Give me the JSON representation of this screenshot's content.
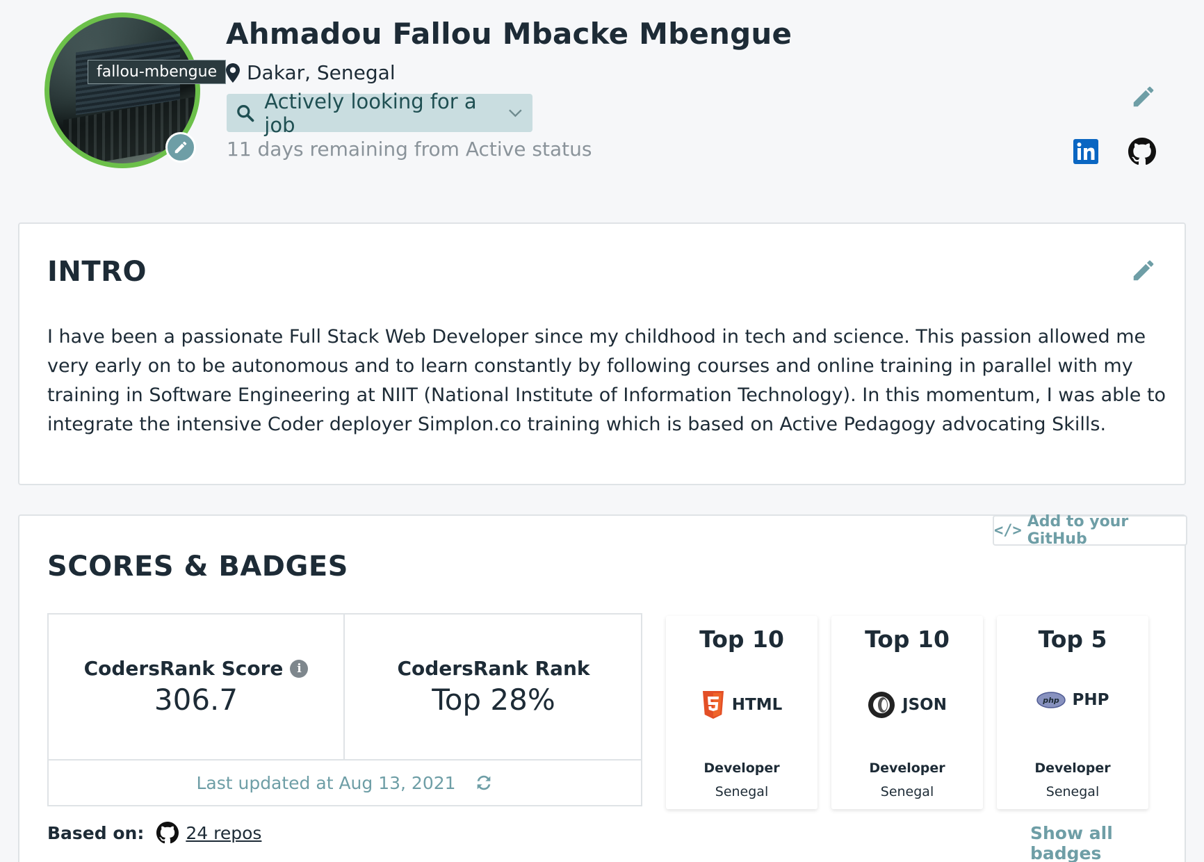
{
  "profile": {
    "username": "fallou-mbengue",
    "name": "Ahmadou Fallou Mbacke Mbengue",
    "location": "Dakar, Senegal",
    "job_status": "Actively looking for a job",
    "remaining": "11 days remaining from Active status",
    "avatar_ring_color": "#6cc04a"
  },
  "intro": {
    "title": "INTRO",
    "text": "I have been a passionate Full Stack Web Developer since my childhood in tech and science. This passion allowed me very early on to be autonomous and to learn constantly by following courses and online training in parallel with my training in Software Engineering at NIIT (National Institute of Information Technology). In this momentum, I was able to integrate the intensive Coder deployer Simplon.co training which is based on Active Pedagogy advocating Skills."
  },
  "scores": {
    "title": "SCORES & BADGES",
    "add_github": "Add to your GitHub",
    "score_label": "CodersRank Score",
    "score_value": "306.7",
    "rank_label": "CodersRank Rank",
    "rank_value": "Top 28%",
    "last_updated": "Last updated at Aug 13, 2021",
    "based_on_label": "Based on:",
    "repos": "24 repos",
    "show_all": "Show all badges",
    "badges": [
      {
        "rank": "Top 10",
        "lang": "HTML",
        "role": "Developer",
        "place": "Senegal",
        "icon": "html5-icon"
      },
      {
        "rank": "Top 10",
        "lang": "JSON",
        "role": "Developer",
        "place": "Senegal",
        "icon": "json-icon"
      },
      {
        "rank": "Top 5",
        "lang": "PHP",
        "role": "Developer",
        "place": "Senegal",
        "icon": "php-icon"
      }
    ]
  },
  "colors": {
    "accent": "#6e9ea6",
    "job_badge_bg": "#c9dde0",
    "text": "#1d2b36",
    "linkedin": "#0a66c2"
  }
}
